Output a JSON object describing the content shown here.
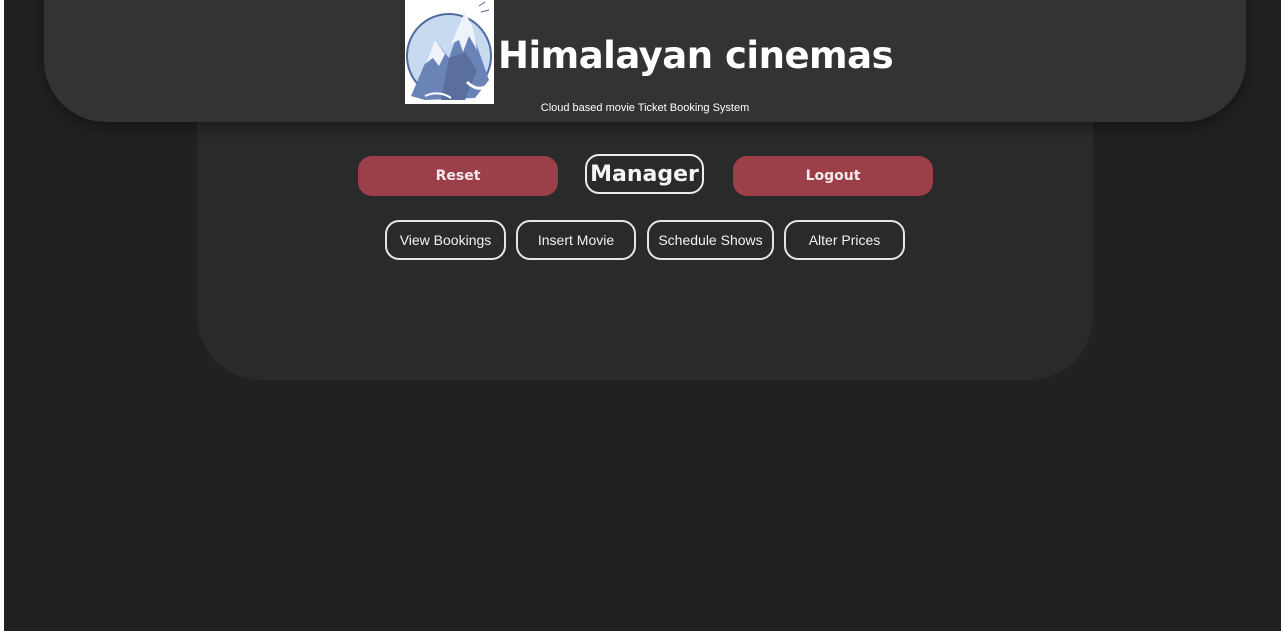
{
  "header": {
    "title": "Himalayan cinemas",
    "tagline": "Cloud based movie Ticket Booking System",
    "logo_icon": "mountain-logo-icon"
  },
  "controls": {
    "reset_label": "Reset",
    "role_label": "Manager",
    "logout_label": "Logout"
  },
  "actions": [
    {
      "label": "View Bookings"
    },
    {
      "label": "Insert Movie"
    },
    {
      "label": "Schedule Shows"
    },
    {
      "label": "Alter Prices"
    }
  ],
  "colors": {
    "background": "#212121",
    "panel": "#2a2a2a",
    "header": "#333333",
    "accent_red": "#9c3f48",
    "text": "#ffffff"
  }
}
